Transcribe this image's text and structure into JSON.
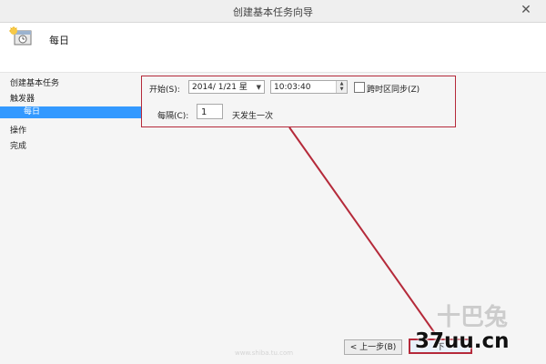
{
  "window": {
    "title": "创建基本任务向导",
    "close_glyph": "✕"
  },
  "header": {
    "title": "每日",
    "icon": "task-scheduler-icon"
  },
  "sidebar": {
    "items": [
      {
        "label": "创建基本任务"
      },
      {
        "label": "触发器"
      },
      {
        "label": "每日",
        "active": true
      },
      {
        "label": "操作"
      },
      {
        "label": "完成"
      }
    ]
  },
  "trigger": {
    "start_label": "开始(S):",
    "date_value": "2014/  1/21 星",
    "time_value": "10:03:40",
    "sync_label": "跨时区同步(Z)",
    "sync_checked": false,
    "every_label": "每隔(C):",
    "every_value": "1",
    "every_suffix": "天发生一次"
  },
  "footer": {
    "back_label": "< 上一步(B)",
    "next_label": "下"
  },
  "watermark": {
    "text": "37uu.cn",
    "faint_text": "十巴兔",
    "url_text": "www.shiba.tu.com"
  },
  "colors": {
    "highlight": "#b52a3a",
    "selection": "#3399ff"
  }
}
